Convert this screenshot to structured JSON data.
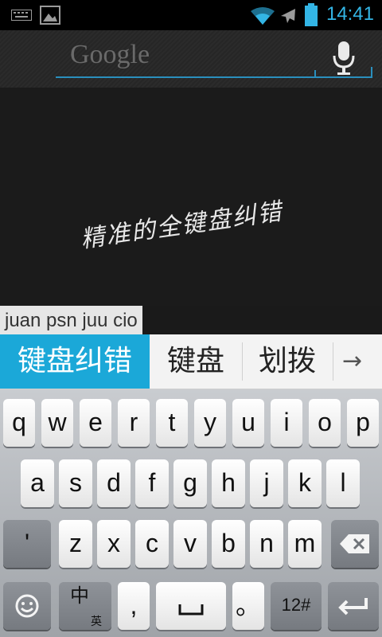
{
  "status_bar": {
    "time": "14:41",
    "icons": [
      "keyboard-icon",
      "image-icon",
      "wifi-icon",
      "airplane-icon",
      "battery-icon"
    ],
    "accent": "#33b5e5"
  },
  "search": {
    "placeholder": "Google",
    "icon": "mic-icon"
  },
  "content": {
    "handwriting_text": "精准的全键盘纠错"
  },
  "composing": {
    "text": "juan psn juu cio"
  },
  "candidates": {
    "items": [
      "键盘纠错",
      "键盘",
      "划拨"
    ],
    "more": "→",
    "selected_color": "#1ba8d8"
  },
  "keyboard": {
    "row1": [
      "q",
      "w",
      "e",
      "r",
      "t",
      "y",
      "u",
      "i",
      "o",
      "p"
    ],
    "row2": [
      "a",
      "s",
      "d",
      "f",
      "g",
      "h",
      "j",
      "k",
      "l"
    ],
    "row3": [
      "'",
      "z",
      "x",
      "c",
      "v",
      "b",
      "n",
      "m"
    ],
    "row4": {
      "emoji": "☺",
      "lang_main": "中",
      "lang_sub": "英",
      "comma": ",",
      "period": "。",
      "sym": "12#"
    }
  }
}
